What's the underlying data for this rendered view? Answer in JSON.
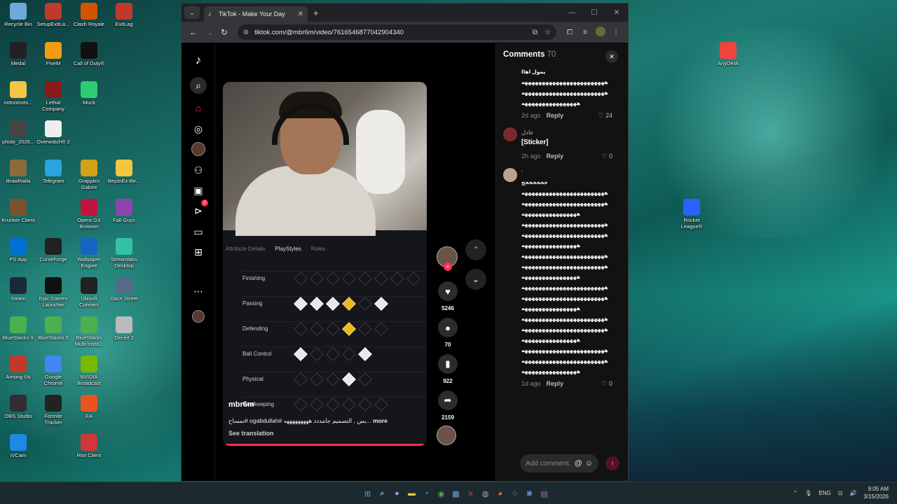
{
  "desktop_icons": [
    {
      "label": "Recycle Bin",
      "icon": "recycle-bin-icon",
      "color": "#6fa8dc"
    },
    {
      "label": "SetupExitLa...",
      "icon": "exitlag-icon",
      "color": "#c0392b"
    },
    {
      "label": "Clash Royale",
      "icon": "clash-royale-icon",
      "color": "#d35400"
    },
    {
      "label": "ExitLag",
      "icon": "exitlag-icon",
      "color": "#c0392b"
    },
    {
      "label": "Medal",
      "icon": "medal-icon",
      "color": "#222222"
    },
    {
      "label": "FiveM",
      "icon": "fivem-icon",
      "color": "#f39c12"
    },
    {
      "label": "Call of Duty®",
      "icon": "call-of-duty-icon",
      "color": "#111111"
    },
    {
      "label": "notnotnots...",
      "icon": "folder-icon",
      "color": "#f4c542"
    },
    {
      "label": "Lethal Company",
      "icon": "lethal-company-icon",
      "color": "#8b1a1a"
    },
    {
      "label": "Muck",
      "icon": "muck-icon",
      "color": "#2ecc71"
    },
    {
      "label": "photo_2026...",
      "icon": "photo-icon",
      "color": "#444444"
    },
    {
      "label": "Overwatch® 2",
      "icon": "overwatch-icon",
      "color": "#eeeeee"
    },
    {
      "label": "Brawlhalla",
      "icon": "brawlhalla-icon",
      "color": "#8e6c3a"
    },
    {
      "label": "Telegram",
      "icon": "telegram-icon",
      "color": "#2aa3df"
    },
    {
      "label": "Grapples Galore",
      "icon": "grapples-icon",
      "color": "#d4a017"
    },
    {
      "label": "BepInEx-Be...",
      "icon": "folder-icon",
      "color": "#f4c542"
    },
    {
      "label": "Krunker Client",
      "icon": "krunker-icon",
      "color": "#7a5230"
    },
    {
      "label": "Opera GX Browser",
      "icon": "opera-gx-icon",
      "color": "#c0143c"
    },
    {
      "label": "Fall Guys",
      "icon": "fall-guys-icon",
      "color": "#8e44ad"
    },
    {
      "label": "PS App",
      "icon": "playstation-icon",
      "color": "#0070d1"
    },
    {
      "label": "CurseForge",
      "icon": "curseforge-icon",
      "color": "#222222"
    },
    {
      "label": "Wallpaper Engine",
      "icon": "wallpaper-engine-icon",
      "color": "#1565c0"
    },
    {
      "label": "Streamlabs Desktop",
      "icon": "streamlabs-icon",
      "color": "#31c3a2"
    },
    {
      "label": "Steam",
      "icon": "steam-icon",
      "color": "#1b2838"
    },
    {
      "label": "Epic Games Launcher",
      "icon": "epic-games-icon",
      "color": "#111111"
    },
    {
      "label": "Ubisoft Connect",
      "icon": "ubisoft-icon",
      "color": "#222222"
    },
    {
      "label": "GarX Street",
      "icon": "garx-street-icon",
      "color": "#556b8a"
    },
    {
      "label": "BlueStacks X",
      "icon": "bluestacks-icon",
      "color": "#4caf50"
    },
    {
      "label": "BlueStacks 5",
      "icon": "bluestacks-icon",
      "color": "#4caf50"
    },
    {
      "label": "BlueStacks Multi-Insta...",
      "icon": "bluestacks-icon",
      "color": "#4caf50"
    },
    {
      "label": "Deceit 2",
      "icon": "deceit-icon",
      "color": "#bbbbbb"
    },
    {
      "label": "Among Us",
      "icon": "among-us-icon",
      "color": "#c0392b"
    },
    {
      "label": "Google Chrome",
      "icon": "chrome-icon",
      "color": "#4285f4"
    },
    {
      "label": "NVIDIA Broadcast",
      "icon": "nvidia-icon",
      "color": "#76b900"
    },
    {
      "label": "OBS Studio",
      "icon": "obs-icon",
      "color": "#302e31"
    },
    {
      "label": "Fortnite Tracker",
      "icon": "fortnite-tracker-icon",
      "color": "#222222"
    },
    {
      "label": "EA",
      "icon": "ea-icon",
      "color": "#e8531f"
    },
    {
      "label": "iVCam",
      "icon": "ivcam-icon",
      "color": "#1e88e5"
    },
    {
      "label": "Riot Client",
      "icon": "riot-client-icon",
      "color": "#d13639"
    },
    {
      "label": "AnyDesk",
      "icon": "anydesk-icon",
      "color": "#ef443b"
    },
    {
      "label": "Rocket League®",
      "icon": "rocket-league-icon",
      "color": "#2962ff"
    }
  ],
  "browser": {
    "tab_title": "TikTok - Make Your Day",
    "url": "tiktok.com/@mbr6m/video/7616546877042904340"
  },
  "video": {
    "game_tabs": [
      "Attribute Details",
      "PlayStyles",
      "Roles"
    ],
    "rows": [
      {
        "label": "Finishing",
        "states": [
          "dim",
          "dim",
          "dim",
          "dim",
          "dim",
          "dim",
          "dim",
          "dim"
        ]
      },
      {
        "label": "Passing",
        "states": [
          "on",
          "on",
          "on",
          "gold",
          "dim",
          "on"
        ]
      },
      {
        "label": "Defending",
        "states": [
          "dim",
          "dim",
          "dim",
          "gold",
          "dim",
          "dim"
        ]
      },
      {
        "label": "Ball Control",
        "states": [
          "on",
          "dim",
          "dim",
          "dim",
          "on"
        ]
      },
      {
        "label": "Physical",
        "states": [
          "dim",
          "dim",
          "dim",
          "on",
          "dim"
        ]
      },
      {
        "label": "Goalkeeping",
        "states": [
          "dim",
          "dim",
          "dim",
          "dim",
          "dim",
          "dim"
        ]
      }
    ],
    "username": "mbr6m",
    "caption": "تمساح# ogabdullah# بس , التصميم جامددد هههههههههه...",
    "more": "more",
    "see_translation": "See translation",
    "likes": "5246",
    "comments": "70",
    "saves": "922",
    "shares": "2159"
  },
  "comments_panel": {
    "title": "Comments",
    "count": "70",
    "input_placeholder": "Add comment...",
    "items": [
      {
        "name": "",
        "lines": [
          "يمول اهاا",
          "ههههههههههههههههههههههههه",
          "ههههههههههههههههههههههههه",
          "ههههههههههههههههه"
        ],
        "time": "2d ago",
        "reply": "Reply",
        "likes": "24"
      },
      {
        "name": "عادل",
        "lines": [
          "[Sticker]"
        ],
        "time": "2h ago",
        "reply": "Reply",
        "likes": "0"
      },
      {
        "name": "'",
        "lines": [
          "خخخخخخخ",
          "ههههههههههههههههههههههههه",
          "ههههههههههههههههههههههههه",
          "ههههههههههههههههه",
          "ههههههههههههههههههههههههه",
          "ههههههههههههههههههههههههه",
          "ههههههههههههههههه",
          "ههههههههههههههههههههههههه",
          "ههههههههههههههههههههههههه",
          "ههههههههههههههههه",
          "ههههههههههههههههههههههههه",
          "ههههههههههههههههههههههههه",
          "ههههههههههههههههه",
          "ههههههههههههههههههههههههه",
          "ههههههههههههههههههههههههه",
          "ههههههههههههههههه",
          "ههههههههههههههههههههههههه",
          "ههههههههههههههههههههههههه",
          "ههههههههههههههههه"
        ],
        "time": "1d ago",
        "reply": "Reply",
        "likes": "0"
      }
    ]
  },
  "taskbar": {
    "lang": "ENG",
    "time": "9:05 AM",
    "date": "3/15/2026"
  },
  "colors": {
    "accent": "#fe2c55",
    "gold": "#e8b923"
  }
}
